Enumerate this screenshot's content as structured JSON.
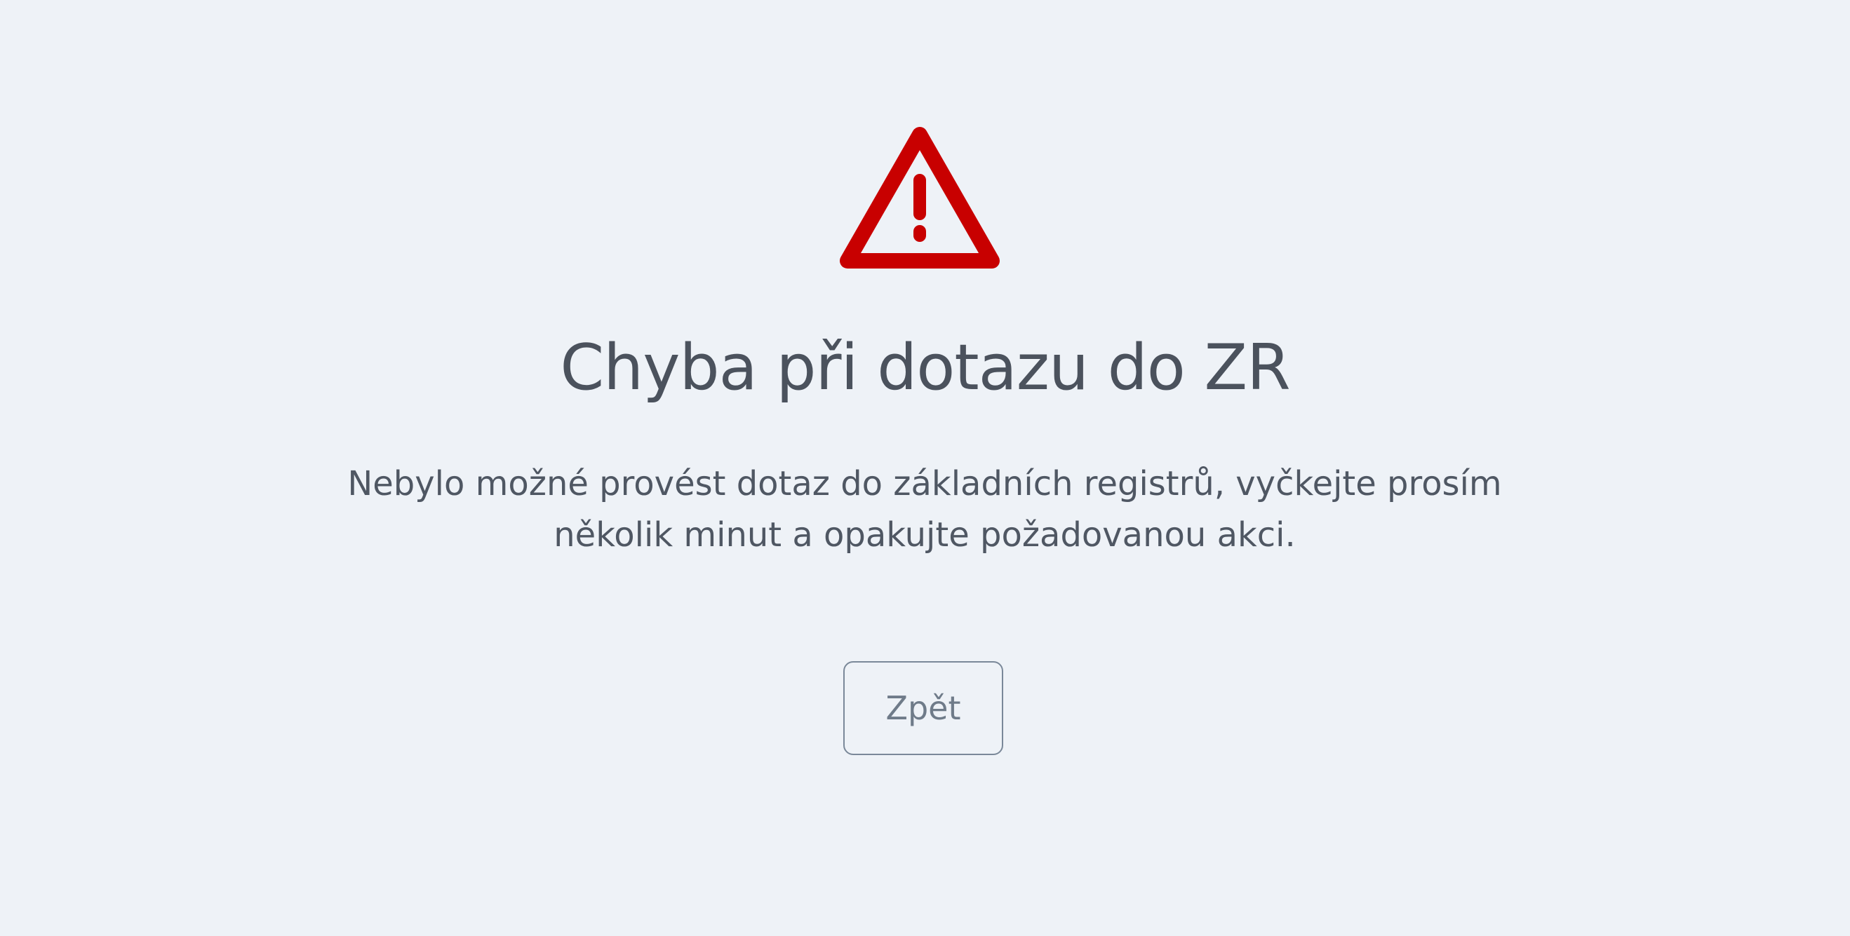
{
  "icon": {
    "name": "warning-icon",
    "color": "#c80000"
  },
  "error": {
    "title": "Chyba při dotazu do ZR",
    "message": "Nebylo možné provést dotaz do základních registrů, vyčkejte prosím několik minut a opakujte požadovanou akci."
  },
  "actions": {
    "back_label": "Zpět"
  },
  "colors": {
    "background": "#eef2f7",
    "text": "#4b525d",
    "button_border": "#7a8899",
    "button_text": "#6f7b89",
    "accent": "#c80000"
  }
}
